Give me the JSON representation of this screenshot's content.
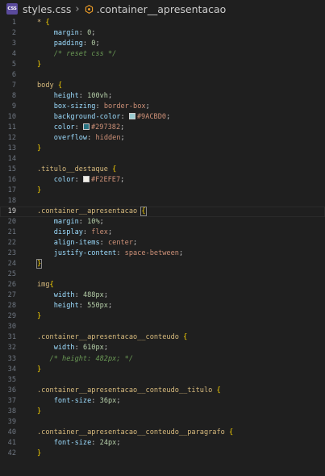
{
  "breadcrumb": {
    "badge": "CSS",
    "file": "styles.css",
    "symbol": ".container__apresentacao"
  },
  "colors": {
    "swatch_9ACBD0": "#9ACBD0",
    "swatch_297382": "#297382",
    "swatch_F2EFE7": "#F2EFE7"
  },
  "lines": [
    {
      "n": "1",
      "tokens": [
        {
          "c": "t-sel",
          "t": "* "
        },
        {
          "c": "t-brace",
          "t": "{"
        }
      ]
    },
    {
      "n": "2",
      "tokens": [
        {
          "c": "",
          "t": "    "
        },
        {
          "c": "t-prop",
          "t": "margin"
        },
        {
          "c": "t-punct",
          "t": ": "
        },
        {
          "c": "t-num",
          "t": "0"
        },
        {
          "c": "t-punct",
          "t": ";"
        }
      ]
    },
    {
      "n": "3",
      "tokens": [
        {
          "c": "",
          "t": "    "
        },
        {
          "c": "t-prop",
          "t": "padding"
        },
        {
          "c": "t-punct",
          "t": ": "
        },
        {
          "c": "t-num",
          "t": "0"
        },
        {
          "c": "t-punct",
          "t": ";"
        }
      ]
    },
    {
      "n": "4",
      "tokens": [
        {
          "c": "",
          "t": "    "
        },
        {
          "c": "t-comment",
          "t": "/* reset css */"
        }
      ]
    },
    {
      "n": "5",
      "tokens": [
        {
          "c": "t-brace",
          "t": "}"
        }
      ]
    },
    {
      "n": "6",
      "tokens": []
    },
    {
      "n": "7",
      "tokens": [
        {
          "c": "t-sel",
          "t": "body "
        },
        {
          "c": "t-brace",
          "t": "{"
        }
      ]
    },
    {
      "n": "8",
      "tokens": [
        {
          "c": "",
          "t": "    "
        },
        {
          "c": "t-prop",
          "t": "height"
        },
        {
          "c": "t-punct",
          "t": ": "
        },
        {
          "c": "t-num",
          "t": "100vh"
        },
        {
          "c": "t-punct",
          "t": ";"
        }
      ]
    },
    {
      "n": "9",
      "tokens": [
        {
          "c": "",
          "t": "    "
        },
        {
          "c": "t-prop",
          "t": "box-sizing"
        },
        {
          "c": "t-punct",
          "t": ": "
        },
        {
          "c": "t-val",
          "t": "border-box"
        },
        {
          "c": "t-punct",
          "t": ";"
        }
      ]
    },
    {
      "n": "10",
      "tokens": [
        {
          "c": "",
          "t": "    "
        },
        {
          "c": "t-prop",
          "t": "background-color"
        },
        {
          "c": "t-punct",
          "t": ": "
        },
        {
          "c": "swatch",
          "t": "#9ACBD0"
        },
        {
          "c": "t-val",
          "t": "#9ACBD0"
        },
        {
          "c": "t-punct",
          "t": ";"
        }
      ]
    },
    {
      "n": "11",
      "tokens": [
        {
          "c": "",
          "t": "    "
        },
        {
          "c": "t-prop",
          "t": "color"
        },
        {
          "c": "t-punct",
          "t": ": "
        },
        {
          "c": "swatch",
          "t": "#297382"
        },
        {
          "c": "t-val",
          "t": "#297382"
        },
        {
          "c": "t-punct",
          "t": ";"
        }
      ]
    },
    {
      "n": "12",
      "tokens": [
        {
          "c": "",
          "t": "    "
        },
        {
          "c": "t-prop",
          "t": "overflow"
        },
        {
          "c": "t-punct",
          "t": ": "
        },
        {
          "c": "t-val",
          "t": "hidden"
        },
        {
          "c": "t-punct",
          "t": ";"
        }
      ]
    },
    {
      "n": "13",
      "tokens": [
        {
          "c": "t-brace",
          "t": "}"
        }
      ]
    },
    {
      "n": "14",
      "tokens": []
    },
    {
      "n": "15",
      "tokens": [
        {
          "c": "t-sel",
          "t": ".titulo__destaque "
        },
        {
          "c": "t-brace",
          "t": "{"
        }
      ]
    },
    {
      "n": "16",
      "tokens": [
        {
          "c": "",
          "t": "    "
        },
        {
          "c": "t-prop",
          "t": "color"
        },
        {
          "c": "t-punct",
          "t": ": "
        },
        {
          "c": "swatch",
          "t": "#F2EFE7"
        },
        {
          "c": "t-val",
          "t": "#F2EFE7"
        },
        {
          "c": "t-punct",
          "t": ";"
        }
      ]
    },
    {
      "n": "17",
      "tokens": [
        {
          "c": "t-brace",
          "t": "}"
        }
      ]
    },
    {
      "n": "18",
      "tokens": []
    },
    {
      "n": "19",
      "active": true,
      "tokens": [
        {
          "c": "t-sel",
          "t": ".container__apresentacao "
        },
        {
          "c": "t-brace bracket-box",
          "t": "{"
        }
      ]
    },
    {
      "n": "20",
      "tokens": [
        {
          "c": "",
          "t": "    "
        },
        {
          "c": "t-prop",
          "t": "margin"
        },
        {
          "c": "t-punct",
          "t": ": "
        },
        {
          "c": "t-num",
          "t": "10%"
        },
        {
          "c": "t-punct",
          "t": ";"
        }
      ]
    },
    {
      "n": "21",
      "tokens": [
        {
          "c": "",
          "t": "    "
        },
        {
          "c": "t-prop",
          "t": "display"
        },
        {
          "c": "t-punct",
          "t": ": "
        },
        {
          "c": "t-val",
          "t": "flex"
        },
        {
          "c": "t-punct",
          "t": ";"
        }
      ]
    },
    {
      "n": "22",
      "tokens": [
        {
          "c": "",
          "t": "    "
        },
        {
          "c": "t-prop",
          "t": "align-items"
        },
        {
          "c": "t-punct",
          "t": ": "
        },
        {
          "c": "t-val",
          "t": "center"
        },
        {
          "c": "t-punct",
          "t": ";"
        }
      ]
    },
    {
      "n": "23",
      "tokens": [
        {
          "c": "",
          "t": "    "
        },
        {
          "c": "t-prop",
          "t": "justify-content"
        },
        {
          "c": "t-punct",
          "t": ": "
        },
        {
          "c": "t-val",
          "t": "space-between"
        },
        {
          "c": "t-punct",
          "t": ";"
        }
      ]
    },
    {
      "n": "24",
      "tokens": [
        {
          "c": "t-brace bracket-box",
          "t": "}"
        }
      ]
    },
    {
      "n": "25",
      "tokens": []
    },
    {
      "n": "26",
      "tokens": [
        {
          "c": "t-sel",
          "t": "img"
        },
        {
          "c": "t-brace",
          "t": "{"
        }
      ]
    },
    {
      "n": "27",
      "tokens": [
        {
          "c": "",
          "t": "    "
        },
        {
          "c": "t-prop",
          "t": "width"
        },
        {
          "c": "t-punct",
          "t": ": "
        },
        {
          "c": "t-num",
          "t": "488px"
        },
        {
          "c": "t-punct",
          "t": ";"
        }
      ]
    },
    {
      "n": "28",
      "tokens": [
        {
          "c": "",
          "t": "    "
        },
        {
          "c": "t-prop",
          "t": "height"
        },
        {
          "c": "t-punct",
          "t": ": "
        },
        {
          "c": "t-num",
          "t": "550px"
        },
        {
          "c": "t-punct",
          "t": ";"
        }
      ]
    },
    {
      "n": "29",
      "tokens": [
        {
          "c": "t-brace",
          "t": "}"
        }
      ]
    },
    {
      "n": "30",
      "tokens": []
    },
    {
      "n": "31",
      "tokens": [
        {
          "c": "t-sel",
          "t": ".container__apresentacao__conteudo "
        },
        {
          "c": "t-brace",
          "t": "{"
        }
      ]
    },
    {
      "n": "32",
      "tokens": [
        {
          "c": "",
          "t": "    "
        },
        {
          "c": "t-prop",
          "t": "width"
        },
        {
          "c": "t-punct",
          "t": ": "
        },
        {
          "c": "t-num",
          "t": "610px"
        },
        {
          "c": "t-punct",
          "t": ";"
        }
      ]
    },
    {
      "n": "33",
      "tokens": [
        {
          "c": "",
          "t": "   "
        },
        {
          "c": "t-comment",
          "t": "/* height: 482px; */"
        }
      ]
    },
    {
      "n": "34",
      "tokens": [
        {
          "c": "t-brace",
          "t": "}"
        }
      ]
    },
    {
      "n": "35",
      "tokens": []
    },
    {
      "n": "36",
      "tokens": [
        {
          "c": "t-sel",
          "t": ".container__apresentacao__conteudo__titulo "
        },
        {
          "c": "t-brace",
          "t": "{"
        }
      ]
    },
    {
      "n": "37",
      "tokens": [
        {
          "c": "",
          "t": "    "
        },
        {
          "c": "t-prop",
          "t": "font-size"
        },
        {
          "c": "t-punct",
          "t": ": "
        },
        {
          "c": "t-num",
          "t": "36px"
        },
        {
          "c": "t-punct",
          "t": ";"
        }
      ]
    },
    {
      "n": "38",
      "tokens": [
        {
          "c": "t-brace",
          "t": "}"
        }
      ]
    },
    {
      "n": "39",
      "tokens": []
    },
    {
      "n": "40",
      "tokens": [
        {
          "c": "t-sel",
          "t": ".container__apresentacao__conteudo__paragrafo "
        },
        {
          "c": "t-brace",
          "t": "{"
        }
      ]
    },
    {
      "n": "41",
      "tokens": [
        {
          "c": "",
          "t": "    "
        },
        {
          "c": "t-prop",
          "t": "font-size"
        },
        {
          "c": "t-punct",
          "t": ": "
        },
        {
          "c": "t-num",
          "t": "24px"
        },
        {
          "c": "t-punct",
          "t": ";"
        }
      ]
    },
    {
      "n": "42",
      "tokens": [
        {
          "c": "t-brace",
          "t": "}"
        }
      ]
    }
  ]
}
